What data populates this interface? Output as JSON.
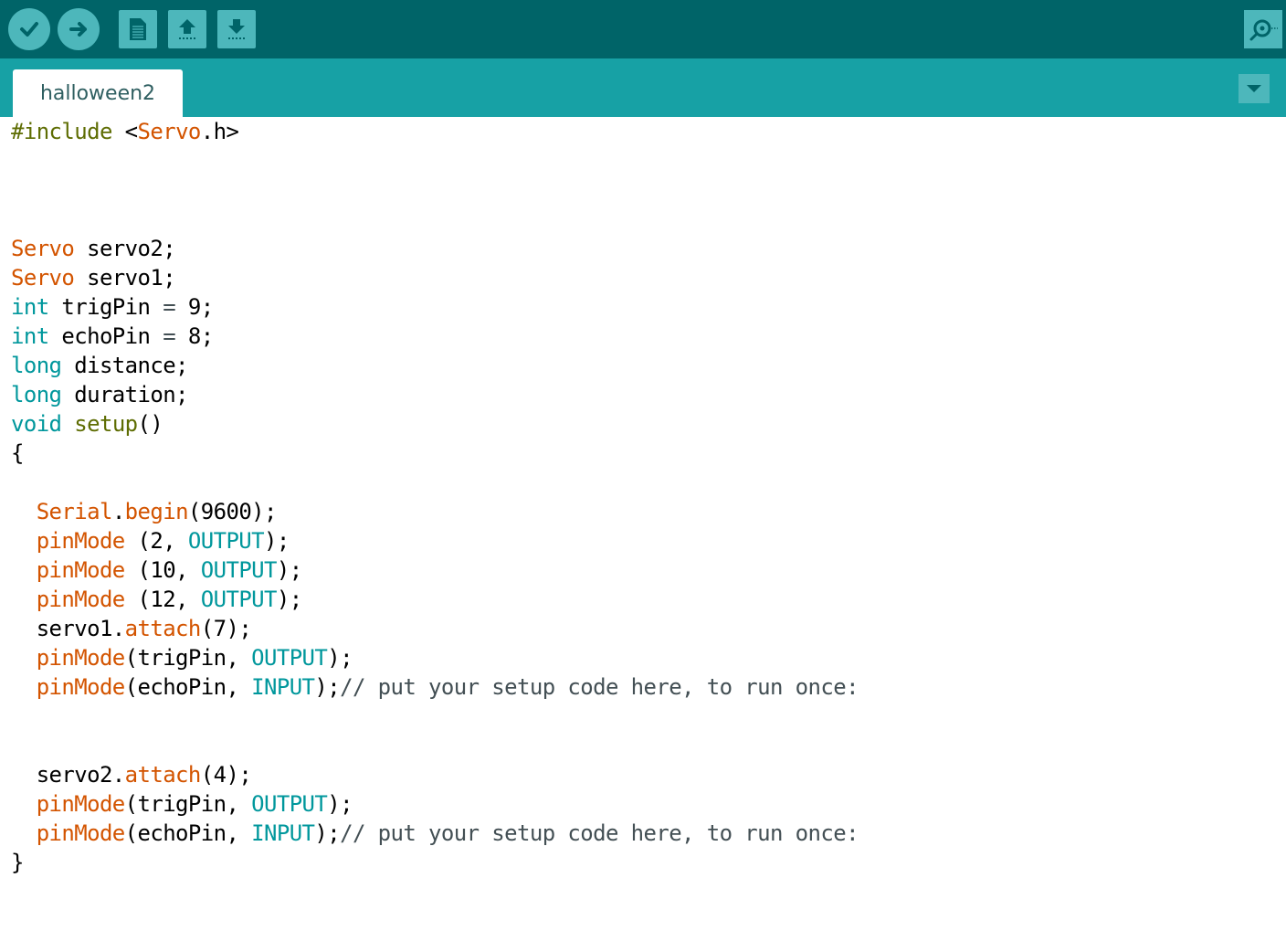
{
  "toolbar": {
    "buttons": [
      {
        "name": "verify",
        "icon": "checkmark-icon"
      },
      {
        "name": "upload",
        "icon": "right-arrow-icon"
      },
      {
        "name": "new",
        "icon": "document-icon"
      },
      {
        "name": "open",
        "icon": "up-arrow-icon"
      },
      {
        "name": "save",
        "icon": "down-arrow-icon"
      },
      {
        "name": "serial-monitor",
        "icon": "magnifier-icon"
      }
    ]
  },
  "tabs": {
    "active": "halloween2",
    "menu_icon": "triangle-down-icon"
  },
  "code": {
    "lines": [
      [
        [
          "#include ",
          "pp"
        ],
        [
          "<",
          "n"
        ],
        [
          "Servo",
          "ty"
        ],
        [
          ".h>",
          "n"
        ]
      ],
      [],
      [],
      [],
      [
        [
          "Servo",
          "ty"
        ],
        [
          " servo2;",
          "n"
        ]
      ],
      [
        [
          "Servo",
          "ty"
        ],
        [
          " servo1;",
          "n"
        ]
      ],
      [
        [
          "int",
          "kw"
        ],
        [
          " trigPin ",
          "n"
        ],
        [
          "=",
          "op"
        ],
        [
          " 9;",
          "n"
        ]
      ],
      [
        [
          "int",
          "kw"
        ],
        [
          " echoPin ",
          "n"
        ],
        [
          "=",
          "op"
        ],
        [
          " 8;",
          "n"
        ]
      ],
      [
        [
          "long",
          "kw"
        ],
        [
          " distance;",
          "n"
        ]
      ],
      [
        [
          "long",
          "kw"
        ],
        [
          " duration;",
          "n"
        ]
      ],
      [
        [
          "void",
          "kw"
        ],
        [
          " ",
          "n"
        ],
        [
          "setup",
          "kf"
        ],
        [
          "()",
          "n"
        ]
      ],
      [
        [
          "{",
          "n"
        ]
      ],
      [],
      [
        [
          "  ",
          "n"
        ],
        [
          "Serial",
          "ty"
        ],
        [
          ".",
          "n"
        ],
        [
          "begin",
          "fn"
        ],
        [
          "(9600);",
          "n"
        ]
      ],
      [
        [
          "  ",
          "n"
        ],
        [
          "pinMode",
          "fn"
        ],
        [
          " (2, ",
          "n"
        ],
        [
          "OUTPUT",
          "ct"
        ],
        [
          ");",
          "n"
        ]
      ],
      [
        [
          "  ",
          "n"
        ],
        [
          "pinMode",
          "fn"
        ],
        [
          " (10, ",
          "n"
        ],
        [
          "OUTPUT",
          "ct"
        ],
        [
          ");",
          "n"
        ]
      ],
      [
        [
          "  ",
          "n"
        ],
        [
          "pinMode",
          "fn"
        ],
        [
          " (12, ",
          "n"
        ],
        [
          "OUTPUT",
          "ct"
        ],
        [
          ");",
          "n"
        ]
      ],
      [
        [
          "  servo1.",
          "n"
        ],
        [
          "attach",
          "fn"
        ],
        [
          "(7);",
          "n"
        ]
      ],
      [
        [
          "  ",
          "n"
        ],
        [
          "pinMode",
          "fn"
        ],
        [
          "(trigPin, ",
          "n"
        ],
        [
          "OUTPUT",
          "ct"
        ],
        [
          ");",
          "n"
        ]
      ],
      [
        [
          "  ",
          "n"
        ],
        [
          "pinMode",
          "fn"
        ],
        [
          "(echoPin, ",
          "n"
        ],
        [
          "INPUT",
          "ct"
        ],
        [
          ");",
          "n"
        ],
        [
          "// put your setup code here, to run once:",
          "cm"
        ]
      ],
      [],
      [],
      [
        [
          "  servo2.",
          "n"
        ],
        [
          "attach",
          "fn"
        ],
        [
          "(4);",
          "n"
        ]
      ],
      [
        [
          "  ",
          "n"
        ],
        [
          "pinMode",
          "fn"
        ],
        [
          "(trigPin, ",
          "n"
        ],
        [
          "OUTPUT",
          "ct"
        ],
        [
          ");",
          "n"
        ]
      ],
      [
        [
          "  ",
          "n"
        ],
        [
          "pinMode",
          "fn"
        ],
        [
          "(echoPin, ",
          "n"
        ],
        [
          "INPUT",
          "ct"
        ],
        [
          ");",
          "n"
        ],
        [
          "// put your setup code here, to run once:",
          "cm"
        ]
      ],
      [
        [
          "}",
          "n"
        ]
      ]
    ]
  },
  "colors": {
    "toolbar_bg": "#006468",
    "tabbar_bg": "#17a1a5",
    "button_bg": "#4db7bb",
    "preprocessor": "#5e6d03",
    "type": "#d35400",
    "keyword": "#00979c",
    "function": "#d35400",
    "constant": "#00979c",
    "comment": "#434f54"
  }
}
